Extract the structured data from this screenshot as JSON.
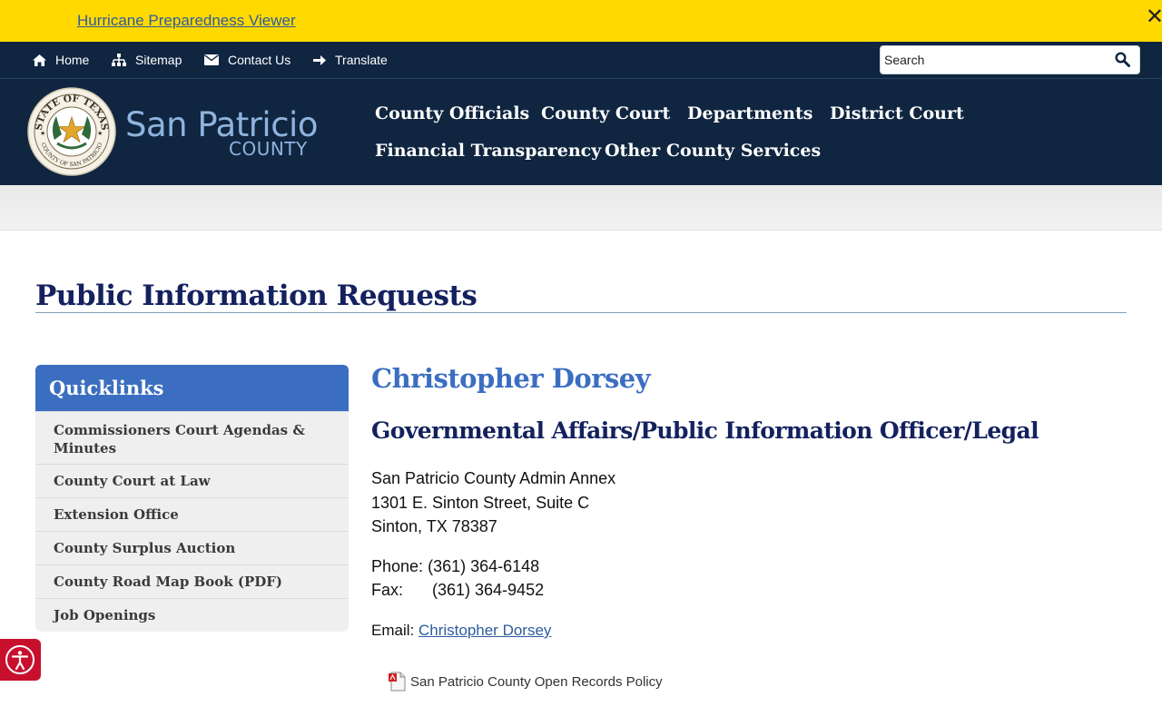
{
  "alert": {
    "link_text": "Hurricane Preparedness Viewer",
    "close_symbol": "✕"
  },
  "utility_nav": {
    "home": "Home",
    "sitemap": "Sitemap",
    "contact": "Contact Us",
    "translate": "Translate"
  },
  "search": {
    "placeholder": "Search"
  },
  "logo": {
    "name": "San Patricio",
    "subtitle": "COUNTY",
    "seal_top_text": "STATE OF TEXAS",
    "seal_bottom_text": "COUNTY OF SAN PATRICIO"
  },
  "main_nav": [
    "County Officials",
    "County Court",
    "Departments",
    "District Court",
    "Financial Transparency",
    "Other County Services"
  ],
  "page": {
    "title": "Public Information Requests"
  },
  "quicklinks": {
    "heading": "Quicklinks",
    "items": [
      "Commissioners Court Agendas & Minutes",
      "County Court at Law",
      "Extension Office",
      "County Surplus Auction",
      "County Road Map Book (PDF)",
      "Job Openings"
    ]
  },
  "contact": {
    "name": "Christopher Dorsey",
    "role": "Governmental Affairs/Public Information Officer/Legal",
    "address": [
      "San Patricio County Admin Annex",
      "1301 E. Sinton Street, Suite C",
      "Sinton, TX 78387"
    ],
    "phone_label": "Phone:",
    "phone": "(361) 364-6148",
    "fax_label": "Fax:",
    "fax": "(361) 364-9452",
    "email_label": "Email:",
    "email_link": "Christopher Dorsey"
  },
  "document": {
    "label": "San Patricio County Open Records Policy"
  },
  "colors": {
    "alert": "#ffd900",
    "header": "#0f2540",
    "accent_blue": "#3b6ec1",
    "title_navy": "#14215e",
    "a11y_red": "#c8102e"
  },
  "icons": [
    "home-icon",
    "sitemap-icon",
    "envelope-icon",
    "arrow-right-icon",
    "search-icon",
    "pdf-icon",
    "accessibility-icon",
    "close-icon"
  ]
}
